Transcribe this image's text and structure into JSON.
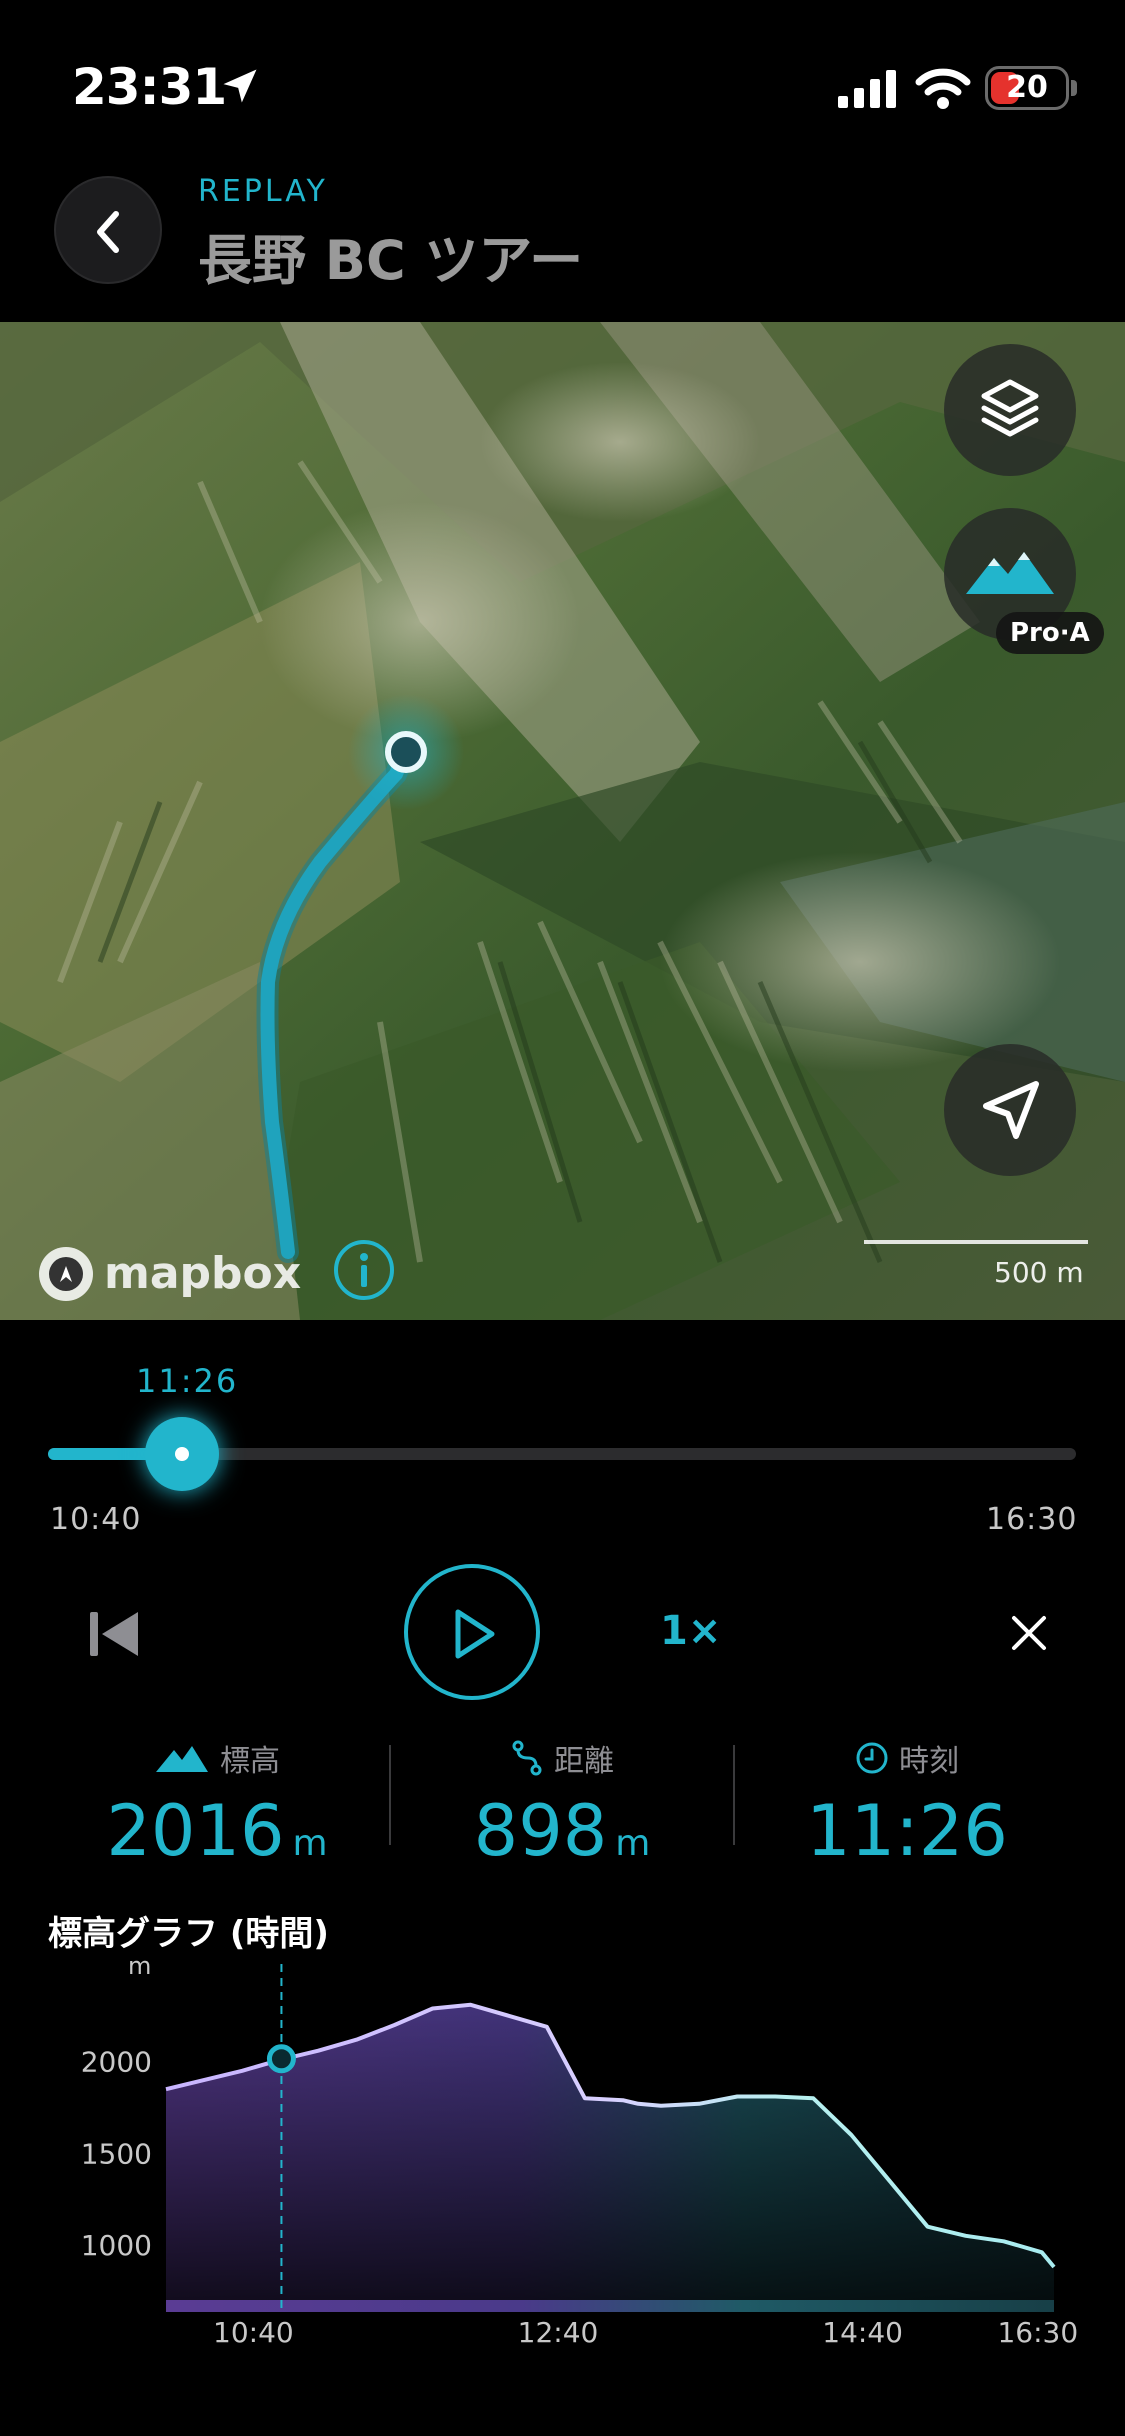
{
  "colors": {
    "accent": "#22b5cc",
    "route": "#1fa3bd",
    "graph_purple": "#6a4aa6",
    "graph_teal": "#1b5c68",
    "battery_red": "#e5322d"
  },
  "status_bar": {
    "time": "23:31",
    "battery": "20",
    "icons": [
      "location-arrow-icon",
      "signal-icon",
      "wifi-icon",
      "battery-icon"
    ]
  },
  "header": {
    "label": "REPLAY",
    "title": "長野 BC ツアー",
    "back_icon": "chevron-left-icon"
  },
  "map": {
    "controls": [
      {
        "name": "layers",
        "icon": "layers-icon"
      },
      {
        "name": "terrain",
        "icon": "mountain-icon",
        "badge": "Pro·A"
      },
      {
        "name": "navigate",
        "icon": "navigation-arrow-icon"
      }
    ],
    "attribution": "mapbox",
    "scale_label": "500 m"
  },
  "timeline": {
    "current_time": "11:26",
    "start_time": "10:40",
    "end_time": "16:30",
    "progress": 0.13
  },
  "controls": {
    "speed": "1×",
    "icons": [
      "skip-back-icon",
      "play-icon",
      "close-icon"
    ]
  },
  "stats": {
    "elevation": {
      "label": "標高",
      "value": "2016",
      "unit": "m",
      "icon": "mountain-icon"
    },
    "distance": {
      "label": "距離",
      "value": "898",
      "unit": "m",
      "icon": "route-icon"
    },
    "time": {
      "label": "時刻",
      "value": "11:26",
      "unit": "",
      "icon": "clock-icon"
    }
  },
  "graph": {
    "title": "標高グラフ (時間)",
    "unit": "m",
    "y_ticks": [
      "2000",
      "1500",
      "1000"
    ],
    "x_ticks": [
      "10:40",
      "12:40",
      "14:40",
      "16:30"
    ]
  },
  "chart_data": {
    "type": "area",
    "ylabel": "m",
    "ylim": [
      700,
      2500
    ],
    "x_labels": [
      "10:40",
      "12:40",
      "14:40",
      "16:30"
    ],
    "y_ticks": [
      2000,
      1500,
      1000
    ],
    "current": {
      "time": "11:26",
      "value": 2016
    },
    "x": [
      0,
      0.5,
      0.75,
      1.0,
      1.25,
      1.5,
      1.75,
      2.0,
      2.25,
      2.5,
      2.75,
      3.0,
      3.1,
      3.25,
      3.5,
      3.75,
      4.0,
      4.25,
      4.5,
      4.75,
      5.0,
      5.25,
      5.5,
      5.75,
      5.83
    ],
    "values": [
      1850,
      1950,
      2010,
      2060,
      2120,
      2200,
      2290,
      2310,
      2250,
      2190,
      1800,
      1790,
      1770,
      1760,
      1770,
      1810,
      1810,
      1800,
      1600,
      1350,
      1100,
      1050,
      1020,
      960,
      880
    ]
  }
}
